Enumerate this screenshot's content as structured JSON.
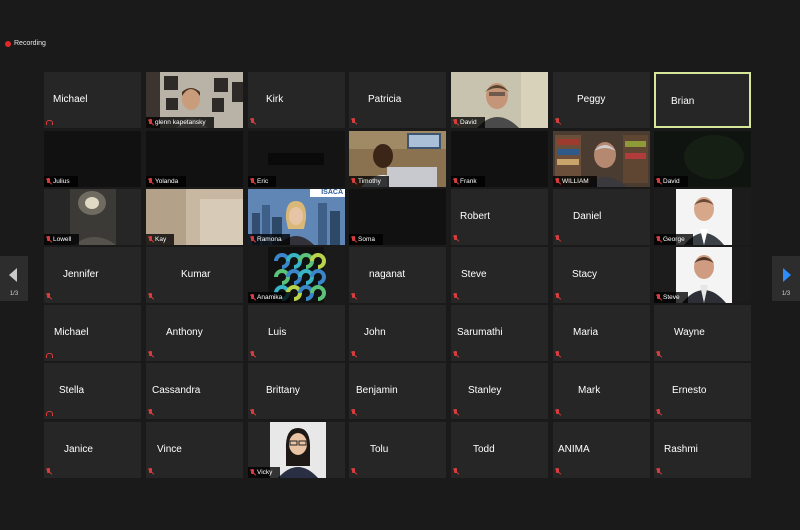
{
  "recording": {
    "label": "Recording",
    "color": "#e02828"
  },
  "accent": {
    "active_speaker_border": "#d6e79a",
    "nav_arrow": "#2d8cff"
  },
  "pagination": {
    "page": "1/3"
  },
  "rows": [
    [
      {
        "name": "Michael",
        "mode": "name",
        "audio": "phone"
      },
      {
        "name": "glenn kapetansky",
        "mode": "video",
        "video": "glenn"
      },
      {
        "name": "Kirk",
        "mode": "name"
      },
      {
        "name": "Patricia",
        "mode": "name"
      },
      {
        "name": "David",
        "mode": "video",
        "video": "david1"
      },
      {
        "name": "Peggy",
        "mode": "name"
      },
      {
        "name": "Brian",
        "mode": "name",
        "active": true,
        "muted": false
      }
    ],
    [
      {
        "name": "Julius",
        "mode": "dark"
      },
      {
        "name": "Yolanda",
        "mode": "dark"
      },
      {
        "name": "Eric",
        "mode": "video",
        "video": "eric"
      },
      {
        "name": "Timothy",
        "mode": "video",
        "video": "timothy"
      },
      {
        "name": "Frank",
        "mode": "dark"
      },
      {
        "name": "WILLIAM",
        "mode": "video",
        "video": "william"
      },
      {
        "name": "David",
        "mode": "video",
        "video": "david2"
      }
    ],
    [
      {
        "name": "Lowell",
        "mode": "video",
        "video": "lowell"
      },
      {
        "name": "Kay",
        "mode": "video",
        "video": "kay"
      },
      {
        "name": "Ramona",
        "mode": "video",
        "video": "ramona"
      },
      {
        "name": "Soma",
        "mode": "dark"
      },
      {
        "name": "Robert",
        "mode": "name"
      },
      {
        "name": "Daniel",
        "mode": "name"
      },
      {
        "name": "George",
        "mode": "video",
        "video": "george"
      }
    ],
    [
      {
        "name": "Jennifer",
        "mode": "name"
      },
      {
        "name": "Kumar",
        "mode": "name"
      },
      {
        "name": "Anamika",
        "mode": "video",
        "video": "anamika"
      },
      {
        "name": "naganat",
        "mode": "name"
      },
      {
        "name": "Steve",
        "mode": "name"
      },
      {
        "name": "Stacy",
        "mode": "name"
      },
      {
        "name": "Steve",
        "mode": "video",
        "video": "steve2"
      }
    ],
    [
      {
        "name": "Michael",
        "mode": "name",
        "audio": "phone"
      },
      {
        "name": "Anthony",
        "mode": "name"
      },
      {
        "name": "Luis",
        "mode": "name"
      },
      {
        "name": "John",
        "mode": "name"
      },
      {
        "name": "Sarumathi",
        "mode": "name"
      },
      {
        "name": "Maria",
        "mode": "name"
      },
      {
        "name": "Wayne",
        "mode": "name"
      }
    ],
    [
      {
        "name": "Stella",
        "mode": "name",
        "audio": "phone"
      },
      {
        "name": "Cassandra",
        "mode": "name"
      },
      {
        "name": "Brittany",
        "mode": "name"
      },
      {
        "name": "Benjamin",
        "mode": "name"
      },
      {
        "name": "Stanley",
        "mode": "name"
      },
      {
        "name": "Mark",
        "mode": "name"
      },
      {
        "name": "Ernesto",
        "mode": "name"
      }
    ],
    [
      {
        "name": "Janice",
        "mode": "name"
      },
      {
        "name": "Vince",
        "mode": "name"
      },
      {
        "name": "Vicky",
        "mode": "video",
        "video": "vicky"
      },
      {
        "name": "Tolu",
        "mode": "name"
      },
      {
        "name": "Todd",
        "mode": "name"
      },
      {
        "name": "ANIMA",
        "mode": "name"
      },
      {
        "name": "Rashmi",
        "mode": "name"
      }
    ]
  ],
  "overlays": {
    "ramona_banner": "ISACA"
  }
}
